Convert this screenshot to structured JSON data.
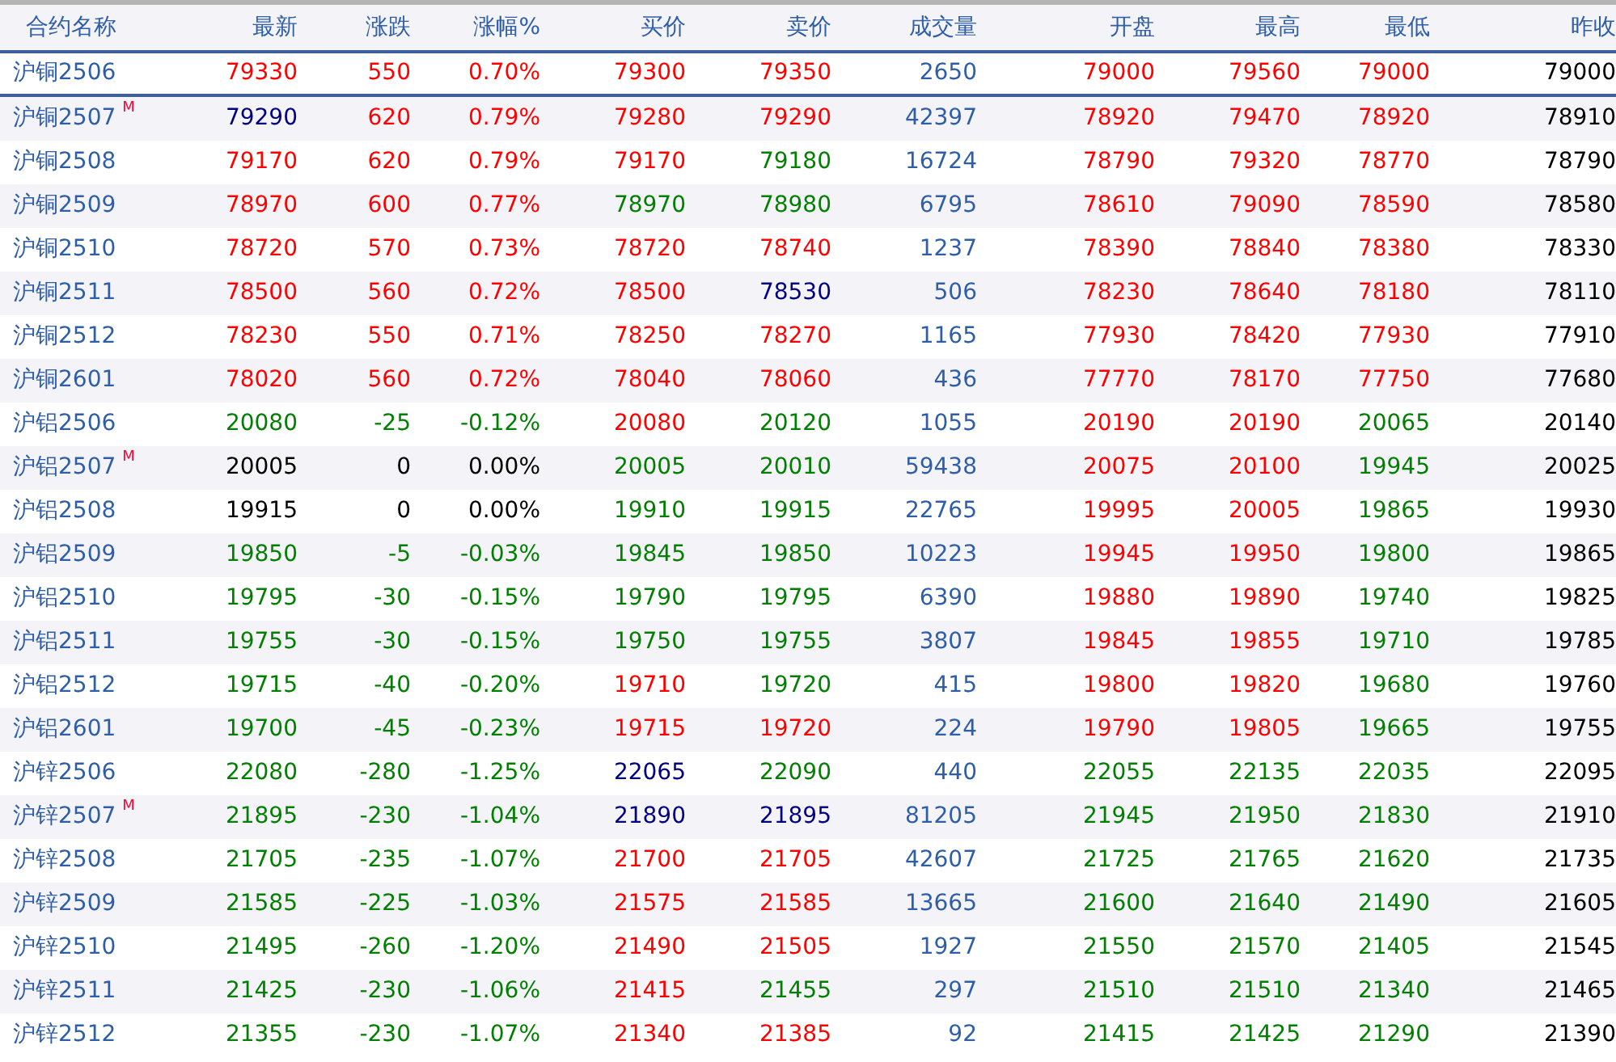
{
  "table": {
    "columns": [
      "合约名称",
      "最新",
      "涨跌",
      "涨幅%",
      "买价",
      "卖价",
      "成交量",
      "开盘",
      "最高",
      "最低",
      "昨收"
    ],
    "rows": [
      {
        "selected": true,
        "cells": [
          {
            "text": "沪铜2506",
            "color": "#2f5ea8"
          },
          {
            "text": "79330",
            "color": "#ff0000"
          },
          {
            "text": "550",
            "color": "#ff0000"
          },
          {
            "text": "0.70%",
            "color": "#ff0000"
          },
          {
            "text": "79300",
            "color": "#ff0000"
          },
          {
            "text": "79350",
            "color": "#ff0000"
          },
          {
            "text": "2650",
            "color": "#2f5ea8"
          },
          {
            "text": "79000",
            "color": "#ff0000"
          },
          {
            "text": "79560",
            "color": "#ff0000"
          },
          {
            "text": "79000",
            "color": "#ff0000"
          },
          {
            "text": "79000",
            "color": "#000000"
          }
        ]
      },
      {
        "selected": false,
        "cells": [
          {
            "text": "沪铜2507",
            "marker": "M",
            "color": "#2f5ea8"
          },
          {
            "text": "79290",
            "color": "#000080"
          },
          {
            "text": "620",
            "color": "#ff0000"
          },
          {
            "text": "0.79%",
            "color": "#ff0000"
          },
          {
            "text": "79280",
            "color": "#ff0000"
          },
          {
            "text": "79290",
            "color": "#ff0000"
          },
          {
            "text": "42397",
            "color": "#2f5ea8"
          },
          {
            "text": "78920",
            "color": "#ff0000"
          },
          {
            "text": "79470",
            "color": "#ff0000"
          },
          {
            "text": "78920",
            "color": "#ff0000"
          },
          {
            "text": "78910",
            "color": "#000000"
          }
        ]
      },
      {
        "selected": false,
        "cells": [
          {
            "text": "沪铜2508",
            "color": "#2f5ea8"
          },
          {
            "text": "79170",
            "color": "#ff0000"
          },
          {
            "text": "620",
            "color": "#ff0000"
          },
          {
            "text": "0.79%",
            "color": "#ff0000"
          },
          {
            "text": "79170",
            "color": "#ff0000"
          },
          {
            "text": "79180",
            "color": "#008000"
          },
          {
            "text": "16724",
            "color": "#2f5ea8"
          },
          {
            "text": "78790",
            "color": "#ff0000"
          },
          {
            "text": "79320",
            "color": "#ff0000"
          },
          {
            "text": "78770",
            "color": "#ff0000"
          },
          {
            "text": "78790",
            "color": "#000000"
          }
        ]
      },
      {
        "selected": false,
        "cells": [
          {
            "text": "沪铜2509",
            "color": "#2f5ea8"
          },
          {
            "text": "78970",
            "color": "#ff0000"
          },
          {
            "text": "600",
            "color": "#ff0000"
          },
          {
            "text": "0.77%",
            "color": "#ff0000"
          },
          {
            "text": "78970",
            "color": "#008000"
          },
          {
            "text": "78980",
            "color": "#008000"
          },
          {
            "text": "6795",
            "color": "#2f5ea8"
          },
          {
            "text": "78610",
            "color": "#ff0000"
          },
          {
            "text": "79090",
            "color": "#ff0000"
          },
          {
            "text": "78590",
            "color": "#ff0000"
          },
          {
            "text": "78580",
            "color": "#000000"
          }
        ]
      },
      {
        "selected": false,
        "cells": [
          {
            "text": "沪铜2510",
            "color": "#2f5ea8"
          },
          {
            "text": "78720",
            "color": "#ff0000"
          },
          {
            "text": "570",
            "color": "#ff0000"
          },
          {
            "text": "0.73%",
            "color": "#ff0000"
          },
          {
            "text": "78720",
            "color": "#ff0000"
          },
          {
            "text": "78740",
            "color": "#ff0000"
          },
          {
            "text": "1237",
            "color": "#2f5ea8"
          },
          {
            "text": "78390",
            "color": "#ff0000"
          },
          {
            "text": "78840",
            "color": "#ff0000"
          },
          {
            "text": "78380",
            "color": "#ff0000"
          },
          {
            "text": "78330",
            "color": "#000000"
          }
        ]
      },
      {
        "selected": false,
        "cells": [
          {
            "text": "沪铜2511",
            "color": "#2f5ea8"
          },
          {
            "text": "78500",
            "color": "#ff0000"
          },
          {
            "text": "560",
            "color": "#ff0000"
          },
          {
            "text": "0.72%",
            "color": "#ff0000"
          },
          {
            "text": "78500",
            "color": "#ff0000"
          },
          {
            "text": "78530",
            "color": "#000080"
          },
          {
            "text": "506",
            "color": "#2f5ea8"
          },
          {
            "text": "78230",
            "color": "#ff0000"
          },
          {
            "text": "78640",
            "color": "#ff0000"
          },
          {
            "text": "78180",
            "color": "#ff0000"
          },
          {
            "text": "78110",
            "color": "#000000"
          }
        ]
      },
      {
        "selected": false,
        "cells": [
          {
            "text": "沪铜2512",
            "color": "#2f5ea8"
          },
          {
            "text": "78230",
            "color": "#ff0000"
          },
          {
            "text": "550",
            "color": "#ff0000"
          },
          {
            "text": "0.71%",
            "color": "#ff0000"
          },
          {
            "text": "78250",
            "color": "#ff0000"
          },
          {
            "text": "78270",
            "color": "#ff0000"
          },
          {
            "text": "1165",
            "color": "#2f5ea8"
          },
          {
            "text": "77930",
            "color": "#ff0000"
          },
          {
            "text": "78420",
            "color": "#ff0000"
          },
          {
            "text": "77930",
            "color": "#ff0000"
          },
          {
            "text": "77910",
            "color": "#000000"
          }
        ]
      },
      {
        "selected": false,
        "cells": [
          {
            "text": "沪铜2601",
            "color": "#2f5ea8"
          },
          {
            "text": "78020",
            "color": "#ff0000"
          },
          {
            "text": "560",
            "color": "#ff0000"
          },
          {
            "text": "0.72%",
            "color": "#ff0000"
          },
          {
            "text": "78040",
            "color": "#ff0000"
          },
          {
            "text": "78060",
            "color": "#ff0000"
          },
          {
            "text": "436",
            "color": "#2f5ea8"
          },
          {
            "text": "77770",
            "color": "#ff0000"
          },
          {
            "text": "78170",
            "color": "#ff0000"
          },
          {
            "text": "77750",
            "color": "#ff0000"
          },
          {
            "text": "77680",
            "color": "#000000"
          }
        ]
      },
      {
        "selected": false,
        "cells": [
          {
            "text": "沪铝2506",
            "color": "#2f5ea8"
          },
          {
            "text": "20080",
            "color": "#008000"
          },
          {
            "text": "-25",
            "color": "#008000"
          },
          {
            "text": "-0.12%",
            "color": "#008000"
          },
          {
            "text": "20080",
            "color": "#ff0000"
          },
          {
            "text": "20120",
            "color": "#008000"
          },
          {
            "text": "1055",
            "color": "#2f5ea8"
          },
          {
            "text": "20190",
            "color": "#ff0000"
          },
          {
            "text": "20190",
            "color": "#ff0000"
          },
          {
            "text": "20065",
            "color": "#008000"
          },
          {
            "text": "20140",
            "color": "#000000"
          }
        ]
      },
      {
        "selected": false,
        "cells": [
          {
            "text": "沪铝2507",
            "marker": "M",
            "color": "#2f5ea8"
          },
          {
            "text": "20005",
            "color": "#000000"
          },
          {
            "text": "0",
            "color": "#000000"
          },
          {
            "text": "0.00%",
            "color": "#000000"
          },
          {
            "text": "20005",
            "color": "#008000"
          },
          {
            "text": "20010",
            "color": "#008000"
          },
          {
            "text": "59438",
            "color": "#2f5ea8"
          },
          {
            "text": "20075",
            "color": "#ff0000"
          },
          {
            "text": "20100",
            "color": "#ff0000"
          },
          {
            "text": "19945",
            "color": "#008000"
          },
          {
            "text": "20025",
            "color": "#000000"
          }
        ]
      },
      {
        "selected": false,
        "cells": [
          {
            "text": "沪铝2508",
            "color": "#2f5ea8"
          },
          {
            "text": "19915",
            "color": "#000000"
          },
          {
            "text": "0",
            "color": "#000000"
          },
          {
            "text": "0.00%",
            "color": "#000000"
          },
          {
            "text": "19910",
            "color": "#008000"
          },
          {
            "text": "19915",
            "color": "#008000"
          },
          {
            "text": "22765",
            "color": "#2f5ea8"
          },
          {
            "text": "19995",
            "color": "#ff0000"
          },
          {
            "text": "20005",
            "color": "#ff0000"
          },
          {
            "text": "19865",
            "color": "#008000"
          },
          {
            "text": "19930",
            "color": "#000000"
          }
        ]
      },
      {
        "selected": false,
        "cells": [
          {
            "text": "沪铝2509",
            "color": "#2f5ea8"
          },
          {
            "text": "19850",
            "color": "#008000"
          },
          {
            "text": "-5",
            "color": "#008000"
          },
          {
            "text": "-0.03%",
            "color": "#008000"
          },
          {
            "text": "19845",
            "color": "#008000"
          },
          {
            "text": "19850",
            "color": "#008000"
          },
          {
            "text": "10223",
            "color": "#2f5ea8"
          },
          {
            "text": "19945",
            "color": "#ff0000"
          },
          {
            "text": "19950",
            "color": "#ff0000"
          },
          {
            "text": "19800",
            "color": "#008000"
          },
          {
            "text": "19865",
            "color": "#000000"
          }
        ]
      },
      {
        "selected": false,
        "cells": [
          {
            "text": "沪铝2510",
            "color": "#2f5ea8"
          },
          {
            "text": "19795",
            "color": "#008000"
          },
          {
            "text": "-30",
            "color": "#008000"
          },
          {
            "text": "-0.15%",
            "color": "#008000"
          },
          {
            "text": "19790",
            "color": "#008000"
          },
          {
            "text": "19795",
            "color": "#008000"
          },
          {
            "text": "6390",
            "color": "#2f5ea8"
          },
          {
            "text": "19880",
            "color": "#ff0000"
          },
          {
            "text": "19890",
            "color": "#ff0000"
          },
          {
            "text": "19740",
            "color": "#008000"
          },
          {
            "text": "19825",
            "color": "#000000"
          }
        ]
      },
      {
        "selected": false,
        "cells": [
          {
            "text": "沪铝2511",
            "color": "#2f5ea8"
          },
          {
            "text": "19755",
            "color": "#008000"
          },
          {
            "text": "-30",
            "color": "#008000"
          },
          {
            "text": "-0.15%",
            "color": "#008000"
          },
          {
            "text": "19750",
            "color": "#008000"
          },
          {
            "text": "19755",
            "color": "#008000"
          },
          {
            "text": "3807",
            "color": "#2f5ea8"
          },
          {
            "text": "19845",
            "color": "#ff0000"
          },
          {
            "text": "19855",
            "color": "#ff0000"
          },
          {
            "text": "19710",
            "color": "#008000"
          },
          {
            "text": "19785",
            "color": "#000000"
          }
        ]
      },
      {
        "selected": false,
        "cells": [
          {
            "text": "沪铝2512",
            "color": "#2f5ea8"
          },
          {
            "text": "19715",
            "color": "#008000"
          },
          {
            "text": "-40",
            "color": "#008000"
          },
          {
            "text": "-0.20%",
            "color": "#008000"
          },
          {
            "text": "19710",
            "color": "#ff0000"
          },
          {
            "text": "19720",
            "color": "#008000"
          },
          {
            "text": "415",
            "color": "#2f5ea8"
          },
          {
            "text": "19800",
            "color": "#ff0000"
          },
          {
            "text": "19820",
            "color": "#ff0000"
          },
          {
            "text": "19680",
            "color": "#008000"
          },
          {
            "text": "19760",
            "color": "#000000"
          }
        ]
      },
      {
        "selected": false,
        "cells": [
          {
            "text": "沪铝2601",
            "color": "#2f5ea8"
          },
          {
            "text": "19700",
            "color": "#008000"
          },
          {
            "text": "-45",
            "color": "#008000"
          },
          {
            "text": "-0.23%",
            "color": "#008000"
          },
          {
            "text": "19715",
            "color": "#ff0000"
          },
          {
            "text": "19720",
            "color": "#ff0000"
          },
          {
            "text": "224",
            "color": "#2f5ea8"
          },
          {
            "text": "19790",
            "color": "#ff0000"
          },
          {
            "text": "19805",
            "color": "#ff0000"
          },
          {
            "text": "19665",
            "color": "#008000"
          },
          {
            "text": "19755",
            "color": "#000000"
          }
        ]
      },
      {
        "selected": false,
        "cells": [
          {
            "text": "沪锌2506",
            "color": "#2f5ea8"
          },
          {
            "text": "22080",
            "color": "#008000"
          },
          {
            "text": "-280",
            "color": "#008000"
          },
          {
            "text": "-1.25%",
            "color": "#008000"
          },
          {
            "text": "22065",
            "color": "#000080"
          },
          {
            "text": "22090",
            "color": "#008000"
          },
          {
            "text": "440",
            "color": "#2f5ea8"
          },
          {
            "text": "22055",
            "color": "#008000"
          },
          {
            "text": "22135",
            "color": "#008000"
          },
          {
            "text": "22035",
            "color": "#008000"
          },
          {
            "text": "22095",
            "color": "#000000"
          }
        ]
      },
      {
        "selected": false,
        "cells": [
          {
            "text": "沪锌2507",
            "marker": "M",
            "color": "#2f5ea8"
          },
          {
            "text": "21895",
            "color": "#008000"
          },
          {
            "text": "-230",
            "color": "#008000"
          },
          {
            "text": "-1.04%",
            "color": "#008000"
          },
          {
            "text": "21890",
            "color": "#000080"
          },
          {
            "text": "21895",
            "color": "#000080"
          },
          {
            "text": "81205",
            "color": "#2f5ea8"
          },
          {
            "text": "21945",
            "color": "#008000"
          },
          {
            "text": "21950",
            "color": "#008000"
          },
          {
            "text": "21830",
            "color": "#008000"
          },
          {
            "text": "21910",
            "color": "#000000"
          }
        ]
      },
      {
        "selected": false,
        "cells": [
          {
            "text": "沪锌2508",
            "color": "#2f5ea8"
          },
          {
            "text": "21705",
            "color": "#008000"
          },
          {
            "text": "-235",
            "color": "#008000"
          },
          {
            "text": "-1.07%",
            "color": "#008000"
          },
          {
            "text": "21700",
            "color": "#ff0000"
          },
          {
            "text": "21705",
            "color": "#ff0000"
          },
          {
            "text": "42607",
            "color": "#2f5ea8"
          },
          {
            "text": "21725",
            "color": "#008000"
          },
          {
            "text": "21765",
            "color": "#008000"
          },
          {
            "text": "21620",
            "color": "#008000"
          },
          {
            "text": "21735",
            "color": "#000000"
          }
        ]
      },
      {
        "selected": false,
        "cells": [
          {
            "text": "沪锌2509",
            "color": "#2f5ea8"
          },
          {
            "text": "21585",
            "color": "#008000"
          },
          {
            "text": "-225",
            "color": "#008000"
          },
          {
            "text": "-1.03%",
            "color": "#008000"
          },
          {
            "text": "21575",
            "color": "#ff0000"
          },
          {
            "text": "21585",
            "color": "#ff0000"
          },
          {
            "text": "13665",
            "color": "#2f5ea8"
          },
          {
            "text": "21600",
            "color": "#008000"
          },
          {
            "text": "21640",
            "color": "#008000"
          },
          {
            "text": "21490",
            "color": "#008000"
          },
          {
            "text": "21605",
            "color": "#000000"
          }
        ]
      },
      {
        "selected": false,
        "cells": [
          {
            "text": "沪锌2510",
            "color": "#2f5ea8"
          },
          {
            "text": "21495",
            "color": "#008000"
          },
          {
            "text": "-260",
            "color": "#008000"
          },
          {
            "text": "-1.20%",
            "color": "#008000"
          },
          {
            "text": "21490",
            "color": "#ff0000"
          },
          {
            "text": "21505",
            "color": "#ff0000"
          },
          {
            "text": "1927",
            "color": "#2f5ea8"
          },
          {
            "text": "21550",
            "color": "#008000"
          },
          {
            "text": "21570",
            "color": "#008000"
          },
          {
            "text": "21405",
            "color": "#008000"
          },
          {
            "text": "21545",
            "color": "#000000"
          }
        ]
      },
      {
        "selected": false,
        "cells": [
          {
            "text": "沪锌2511",
            "color": "#2f5ea8"
          },
          {
            "text": "21425",
            "color": "#008000"
          },
          {
            "text": "-230",
            "color": "#008000"
          },
          {
            "text": "-1.06%",
            "color": "#008000"
          },
          {
            "text": "21415",
            "color": "#ff0000"
          },
          {
            "text": "21455",
            "color": "#008000"
          },
          {
            "text": "297",
            "color": "#2f5ea8"
          },
          {
            "text": "21510",
            "color": "#008000"
          },
          {
            "text": "21510",
            "color": "#008000"
          },
          {
            "text": "21340",
            "color": "#008000"
          },
          {
            "text": "21465",
            "color": "#000000"
          }
        ]
      },
      {
        "selected": false,
        "cells": [
          {
            "text": "沪锌2512",
            "color": "#2f5ea8"
          },
          {
            "text": "21355",
            "color": "#008000"
          },
          {
            "text": "-230",
            "color": "#008000"
          },
          {
            "text": "-1.07%",
            "color": "#008000"
          },
          {
            "text": "21340",
            "color": "#ff0000"
          },
          {
            "text": "21385",
            "color": "#ff0000"
          },
          {
            "text": "92",
            "color": "#2f5ea8"
          },
          {
            "text": "21415",
            "color": "#008000"
          },
          {
            "text": "21425",
            "color": "#008000"
          },
          {
            "text": "21290",
            "color": "#008000"
          },
          {
            "text": "21390",
            "color": "#000000"
          }
        ]
      }
    ]
  }
}
